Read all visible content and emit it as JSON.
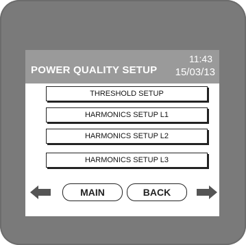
{
  "header": {
    "title": "POWER QUALITY SETUP",
    "time": "11:43",
    "date": "15/03/13"
  },
  "menu": {
    "items": [
      {
        "label": "THRESHOLD SETUP"
      },
      {
        "label": "HARMONICS SETUP L1"
      },
      {
        "label": "HARMONICS SETUP L2"
      },
      {
        "label": "HARMONICS SETUP L3"
      }
    ]
  },
  "nav": {
    "main_label": "MAIN",
    "back_label": "BACK",
    "left_icon": "arrow-left-icon",
    "right_icon": "arrow-right-icon"
  },
  "colors": {
    "bezel": "#7a7a7a",
    "header": "#9a9a9a",
    "arrow": "#555555"
  }
}
